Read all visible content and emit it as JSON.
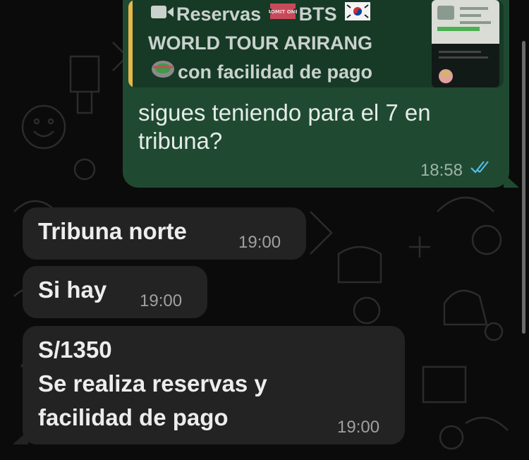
{
  "colors": {
    "background": "#0b0b0b",
    "outgoing_bubble": "#1f4a31",
    "incoming_bubble": "#232323",
    "quote_accent": "#e8b74a",
    "read_ticks": "#53bdeb"
  },
  "quoted_message": {
    "line1_before": "Reservas",
    "line1_after": "BTS",
    "line2": "WORLD TOUR ARIRANG",
    "line3": "con facilidad de pago",
    "icons": [
      "video-camera-icon",
      "admit-one-ticket-icon",
      "south-korea-flag-icon",
      "stadium-icon"
    ],
    "ticket_label": "ADMIT ONE"
  },
  "outgoing": {
    "text": "sigues teniendo para el 7 en tribuna?",
    "time": "18:58",
    "status": "read"
  },
  "incoming": [
    {
      "text": "Tribuna norte",
      "time": "19:00"
    },
    {
      "text": "Si hay",
      "time": "19:00"
    },
    {
      "text_lines": [
        "S/1350",
        "Se realiza reservas y",
        "facilidad de pago"
      ],
      "time": "19:00"
    }
  ]
}
